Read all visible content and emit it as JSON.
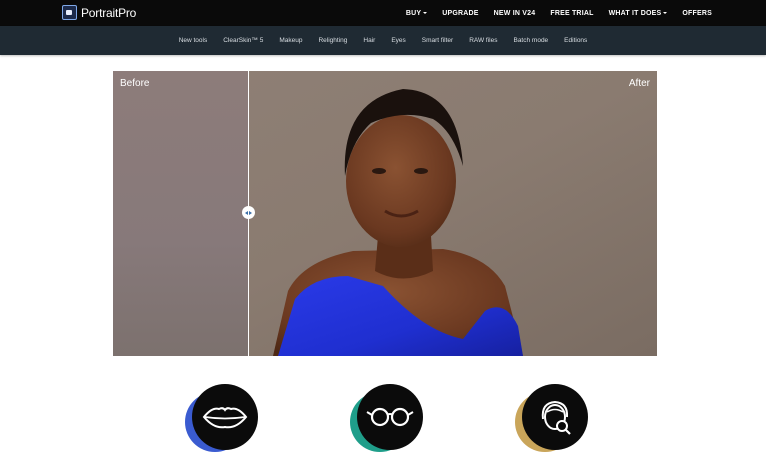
{
  "brand": {
    "name": "PortraitPro",
    "logo_icon": "portraitpro-logo-icon"
  },
  "topnav": {
    "items": [
      {
        "label": "BUY",
        "has_caret": true
      },
      {
        "label": "UPGRADE",
        "has_caret": false
      },
      {
        "label": "NEW IN V24",
        "has_caret": false
      },
      {
        "label": "FREE TRIAL",
        "has_caret": false
      },
      {
        "label": "WHAT IT DOES",
        "has_caret": true
      },
      {
        "label": "OFFERS",
        "has_caret": false
      }
    ]
  },
  "subnav": {
    "items": [
      "New tools",
      "ClearSkin™ 5",
      "Makeup",
      "Relighting",
      "Hair",
      "Eyes",
      "Smart filter",
      "RAW files",
      "Batch mode",
      "Editions"
    ]
  },
  "comparison": {
    "before_label": "Before",
    "after_label": "After",
    "slider_position": 0.25,
    "handle_icon": "left-right-arrows-icon"
  },
  "features": [
    {
      "icon": "lips-icon",
      "accent": "#3a5bd0"
    },
    {
      "icon": "glasses-icon",
      "accent": "#1f9e8a"
    },
    {
      "icon": "face-search-icon",
      "accent": "#c9a55a"
    }
  ],
  "colors": {
    "topbar": "#0a0a0a",
    "subbar": "#1f2a33",
    "dress": "#1f2fd0"
  }
}
